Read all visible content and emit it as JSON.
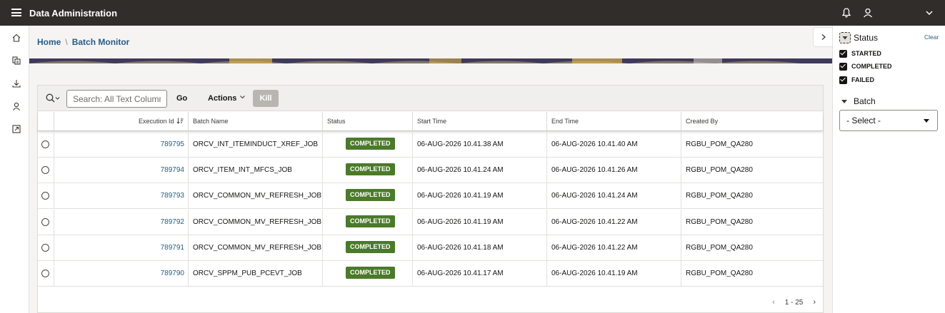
{
  "header": {
    "title": "Data Administration"
  },
  "breadcrumb": {
    "home": "Home",
    "separator": "\\",
    "current": "Batch Monitor"
  },
  "toolbar": {
    "search_placeholder": "Search: All Text Columns",
    "go_label": "Go",
    "actions_label": "Actions",
    "kill_label": "Kill"
  },
  "table": {
    "columns": [
      "Execution Id",
      "Batch Name",
      "Status",
      "Start Time",
      "End Time",
      "Created By"
    ],
    "rows": [
      {
        "id": "789795",
        "batch": "ORCV_INT_ITEMINDUCT_XREF_JOB",
        "status": "COMPLETED",
        "start": "06-AUG-2026 10.41.38 AM",
        "end": "06-AUG-2026 10.41.40 AM",
        "by": "RGBU_POM_QA280"
      },
      {
        "id": "789794",
        "batch": "ORCV_ITEM_INT_MFCS_JOB",
        "status": "COMPLETED",
        "start": "06-AUG-2026 10.41.24 AM",
        "end": "06-AUG-2026 10.41.26 AM",
        "by": "RGBU_POM_QA280"
      },
      {
        "id": "789793",
        "batch": "ORCV_COMMON_MV_REFRESH_JOB",
        "status": "COMPLETED",
        "start": "06-AUG-2026 10.41.19 AM",
        "end": "06-AUG-2026 10.41.24 AM",
        "by": "RGBU_POM_QA280"
      },
      {
        "id": "789792",
        "batch": "ORCV_COMMON_MV_REFRESH_JOB",
        "status": "COMPLETED",
        "start": "06-AUG-2026 10.41.19 AM",
        "end": "06-AUG-2026 10.41.22 AM",
        "by": "RGBU_POM_QA280"
      },
      {
        "id": "789791",
        "batch": "ORCV_COMMON_MV_REFRESH_JOB",
        "status": "COMPLETED",
        "start": "06-AUG-2026 10.41.18 AM",
        "end": "06-AUG-2026 10.41.22 AM",
        "by": "RGBU_POM_QA280"
      },
      {
        "id": "789790",
        "batch": "ORCV_SPPM_PUB_PCEVT_JOB",
        "status": "COMPLETED",
        "start": "06-AUG-2026 10.41.17 AM",
        "end": "06-AUG-2026 10.41.19 AM",
        "by": "RGBU_POM_QA280"
      }
    ],
    "status_color": "#4a7a2a"
  },
  "pagination": {
    "range": "1 - 25"
  },
  "facets": {
    "status_title": "Status",
    "clear_label": "Clear",
    "options": [
      "STARTED",
      "COMPLETED",
      "FAILED"
    ],
    "batch_title": "Batch",
    "batch_select": "- Select -"
  },
  "colors": {
    "header_bg": "#312d2a",
    "link": "#265d85"
  }
}
